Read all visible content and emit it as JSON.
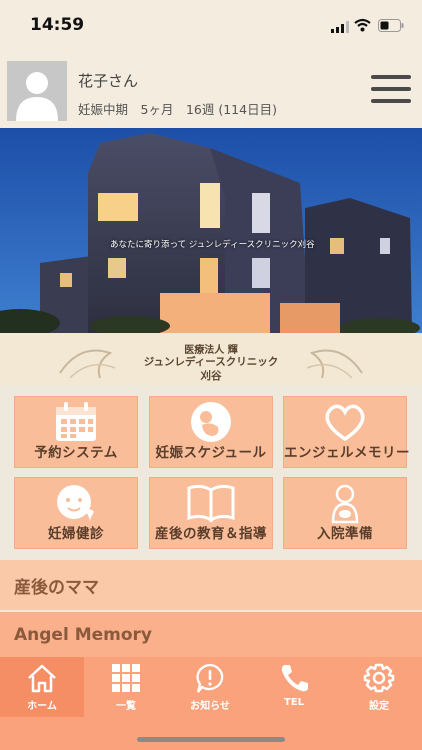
{
  "status_bar": {
    "time": "14:59"
  },
  "profile": {
    "name": "花子さん",
    "pregnancy_status": "妊娠中期　5ヶ月　16週 (114日目)"
  },
  "hero": {
    "caption": "あなたに寄り添って ジュンレディースクリニック刈谷"
  },
  "clinic_banner": {
    "line1": "医療法人 輝",
    "line2": "ジュンレディースクリニック",
    "line3": "刈谷"
  },
  "tiles": [
    {
      "label": "予約システム",
      "icon": "calendar-icon"
    },
    {
      "label": "妊娠スケジュール",
      "icon": "baby-in-womb-icon"
    },
    {
      "label": "エンジェルメモリー",
      "icon": "heart-icon"
    },
    {
      "label": "妊婦健診",
      "icon": "baby-face-icon"
    },
    {
      "label": "産後の教育＆指導",
      "icon": "book-icon"
    },
    {
      "label": "入院準備",
      "icon": "mother-icon"
    }
  ],
  "sections": [
    {
      "label": "産後のママ"
    },
    {
      "label": "Angel Memory"
    }
  ],
  "tabbar": {
    "items": [
      {
        "label": "ホーム",
        "icon": "home-icon"
      },
      {
        "label": "一覧",
        "icon": "grid-icon"
      },
      {
        "label": "お知らせ",
        "icon": "notice-icon"
      },
      {
        "label": "TEL",
        "icon": "phone-icon"
      },
      {
        "label": "設定",
        "icon": "settings-icon"
      }
    ]
  },
  "colors": {
    "background": "#efe8dc",
    "tile": "#f9be99",
    "tabbar": "#f9a27b",
    "tab_active": "#f58e64",
    "section_1": "#f9c9a8",
    "section_2": "#fab08a"
  }
}
